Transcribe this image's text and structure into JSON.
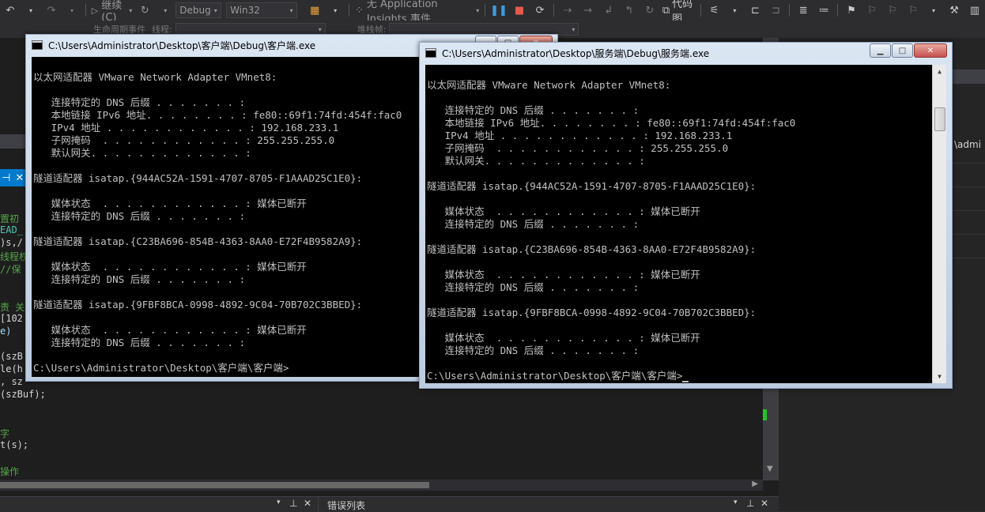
{
  "toolbar": {
    "continue_label": "继续(C)",
    "config_value": "Debug",
    "platform_value": "Win32",
    "insights_label": "无 Application Insights 事件",
    "code_map_label": "代码图"
  },
  "toolbar2": {
    "events_label": "生命周期事件",
    "thread_label": "线程:",
    "stack_label": "堆栈帧:"
  },
  "editor": {
    "code_lines": [
      {
        "text": "置初",
        "color": "#57a64a"
      },
      {
        "text": "EAD_",
        "color": "#4ec9b0"
      },
      {
        "text": ")s,/",
        "color": "#d4d4d4"
      },
      {
        "text": "线程权",
        "color": "#57a64a"
      },
      {
        "text": "//保",
        "color": "#57a64a"
      },
      {
        "text": "责 关",
        "color": "#57a64a"
      },
      {
        "text": "[102",
        "color": "#d4d4d4"
      },
      {
        "text": "e)",
        "color": "#9cdcfe"
      },
      {
        "text": "(szB",
        "color": "#d4d4d4"
      },
      {
        "text": "le(h",
        "color": "#d4d4d4"
      },
      {
        "text": ", sz",
        "color": "#d4d4d4"
      },
      {
        "text": "(szBuf);",
        "color": "#d4d4d4"
      },
      {
        "text": "字",
        "color": "#57a64a"
      },
      {
        "text": "t(s);",
        "color": "#d4d4d4"
      },
      {
        "text": "操作",
        "color": "#57a64a"
      }
    ],
    "bottom_tab": "错误列表",
    "right_admin": "\\admi"
  },
  "client_window": {
    "title": "C:\\Users\\Administrator\\Desktop\\客户端\\Debug\\客户端.exe",
    "lines": [
      "",
      "以太网适配器 VMware Network Adapter VMnet8:",
      "",
      "   连接特定的 DNS 后缀 . . . . . . . :",
      "   本地链接 IPv6 地址. . . . . . . . : fe80::69f1:74fd:454f:fac0",
      "   IPv4 地址 . . . . . . . . . . . . : 192.168.233.1",
      "   子网掩码  . . . . . . . . . . . . : 255.255.255.0",
      "   默认网关. . . . . . . . . . . . . :",
      "",
      "隧道适配器 isatap.{944AC52A-1591-4707-8705-F1AAAD25C1E0}:",
      "",
      "   媒体状态  . . . . . . . . . . . . : 媒体已断开",
      "   连接特定的 DNS 后缀 . . . . . . . :",
      "",
      "隧道适配器 isatap.{C23BA696-854B-4363-8AA0-E72F4B9582A9}:",
      "",
      "   媒体状态  . . . . . . . . . . . . : 媒体已断开",
      "   连接特定的 DNS 后缀 . . . . . . . :",
      "",
      "隧道适配器 isatap.{9FBF8BCA-0998-4892-9C04-70B702C3BBED}:",
      "",
      "   媒体状态  . . . . . . . . . . . . : 媒体已断开",
      "   连接特定的 DNS 后缀 . . . . . . . :",
      "",
      "C:\\Users\\Administrator\\Desktop\\客户端\\客户端>"
    ]
  },
  "server_window": {
    "title": "C:\\Users\\Administrator\\Desktop\\服务端\\Debug\\服务端.exe",
    "lines": [
      "",
      "以太网适配器 VMware Network Adapter VMnet8:",
      "",
      "   连接特定的 DNS 后缀 . . . . . . . :",
      "   本地链接 IPv6 地址. . . . . . . . : fe80::69f1:74fd:454f:fac0",
      "   IPv4 地址 . . . . . . . . . . . . : 192.168.233.1",
      "   子网掩码  . . . . . . . . . . . . : 255.255.255.0",
      "   默认网关. . . . . . . . . . . . . :",
      "",
      "隧道适配器 isatap.{944AC52A-1591-4707-8705-F1AAAD25C1E0}:",
      "",
      "   媒体状态  . . . . . . . . . . . . : 媒体已断开",
      "   连接特定的 DNS 后缀 . . . . . . . :",
      "",
      "隧道适配器 isatap.{C23BA696-854B-4363-8AA0-E72F4B9582A9}:",
      "",
      "   媒体状态  . . . . . . . . . . . . : 媒体已断开",
      "   连接特定的 DNS 后缀 . . . . . . . :",
      "",
      "隧道适配器 isatap.{9FBF8BCA-0998-4892-9C04-70B702C3BBED}:",
      "",
      "   媒体状态  . . . . . . . . . . . . : 媒体已断开",
      "   连接特定的 DNS 后缀 . . . . . . . :",
      "",
      "C:\\Users\\Administrator\\Desktop\\客户端\\客户端>"
    ]
  },
  "colors": {
    "vs_background": "#2d2d30",
    "editor_background": "#1e1e1e",
    "accent_blue": "#007acc",
    "console_background": "#000000",
    "console_text": "#c0c0c0"
  }
}
